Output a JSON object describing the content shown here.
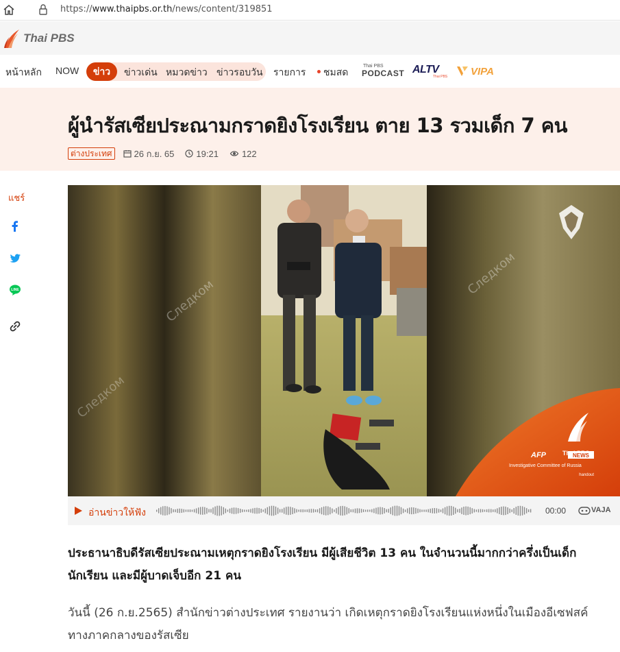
{
  "browser": {
    "url_scheme": "https://",
    "url_host": "www.thaipbs.or.th",
    "url_path": "/news/content/319851"
  },
  "site": {
    "logo_text": "Thai PBS",
    "brand_color": "#d43e0a"
  },
  "nav": {
    "items": [
      "หน้าหลัก",
      "NOW",
      "ข่าว",
      "ข่าวเด่น",
      "หมวดข่าว",
      "ข่าวรอบวัน",
      "รายการ",
      "ชมสด"
    ],
    "active": "ข่าว",
    "podcast_small": "Thai PBS",
    "podcast_big": "PODCAST",
    "altv": "ALTV",
    "altv_sub": "Thai PBS",
    "vipa": "VIPA"
  },
  "article": {
    "title": "ผู้นำรัสเซียประณามกราดยิงโรงเรียน ตาย 13 รวมเด็ก 7 คน",
    "category": "ต่างประเทศ",
    "date": "26 ก.ย. 65",
    "time": "19:21",
    "views": "122",
    "lead": "ประธานาธิบดีรัสเซียประณามเหตุกราดยิงโรงเรียน มีผู้เสียชีวิต 13 คน ในจำนวนนี้มากกว่าครึ่งเป็นเด็กนักเรียน และมีผู้บาดเจ็บอีก 21 คน",
    "body": "วันนี้ (26 ก.ย.2565) สำนักข่าวต่างประเทศ รายงานว่า เกิดเหตุกราดยิงโรงเรียนแห่งหนึ่งในเมืองอีเซฟสค์ ทางภาคกลางของรัสเซีย"
  },
  "share": {
    "label": "แชร์",
    "icons": [
      "facebook-icon",
      "twitter-icon",
      "line-icon",
      "link-icon"
    ]
  },
  "hero": {
    "watermark": "Следком",
    "afp": "AFP",
    "badge_brand": "Thai PBS",
    "badge_news": "NEWS",
    "credit": "Investigative Committee of Russia",
    "credit_sub": "handout"
  },
  "audio": {
    "label": "อ่านข่าวให้ฟัง",
    "time": "00:00",
    "engine": "VAJA"
  }
}
